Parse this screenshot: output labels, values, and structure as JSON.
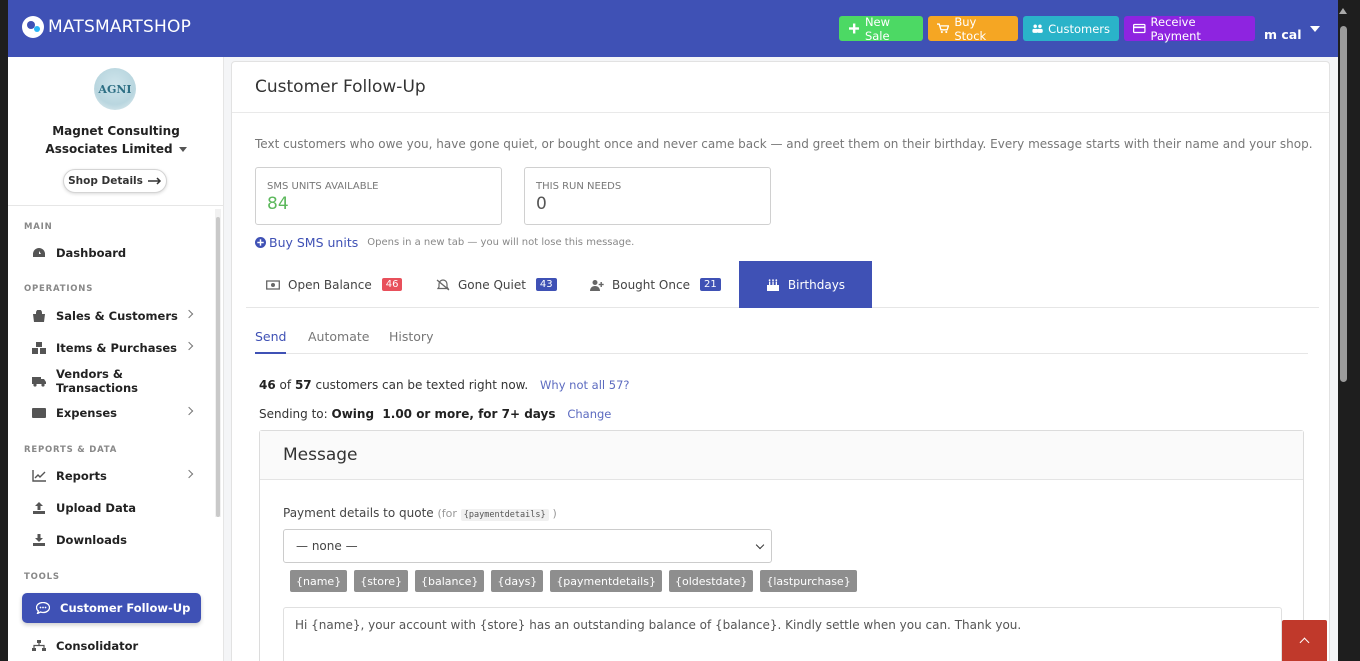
{
  "app": {
    "brand": "MATSMARTSHOP",
    "user": "m cal"
  },
  "topbar": {
    "new_sale": "New Sale",
    "buy_stock": "Buy Stock",
    "customers": "Customers",
    "receive_payment": "Receive Payment"
  },
  "sidebar": {
    "shop_logo_text": "AGNI",
    "shop_name": "Magnet Consulting Associates Limited",
    "shop_details": "Shop Details",
    "sections": {
      "main": "MAIN",
      "operations": "OPERATIONS",
      "reports": "REPORTS & DATA",
      "tools": "TOOLS"
    },
    "items": {
      "dashboard": "Dashboard",
      "sales": "Sales & Customers",
      "items": "Items & Purchases",
      "vendors": "Vendors & Transactions",
      "expenses": "Expenses",
      "reports": "Reports",
      "upload": "Upload Data",
      "downloads": "Downloads",
      "followup": "Customer Follow-Up",
      "consolidator": "Consolidator"
    }
  },
  "main": {
    "title": "Customer Follow-Up",
    "intro": "Text customers who owe you, have gone quiet, or bought once and never came back — and greet them on their birthday. Every message starts with their name and your shop.",
    "sms_label": "SMS UNITS AVAILABLE",
    "sms_value": "84",
    "run_label": "THIS RUN NEEDS",
    "run_value": "0",
    "buy_sms": "Buy SMS units",
    "buy_note": "Opens in a new tab — you will not lose this message.",
    "tabs": [
      {
        "label": "Open Balance",
        "count": "46",
        "color": "#e8505b"
      },
      {
        "label": "Gone Quiet",
        "count": "43",
        "color": "#3f51b5"
      },
      {
        "label": "Bought Once",
        "count": "21",
        "color": "#3f51b5"
      },
      {
        "label": "Birthdays"
      }
    ],
    "subtabs": {
      "send": "Send",
      "automate": "Automate",
      "history": "History"
    },
    "count_a": "46",
    "count_of": "of",
    "count_b": "57",
    "count_text": "customers can be texted right now.",
    "why_not": "Why not all 57?",
    "sending_label": "Sending to:",
    "sending_value": "Owing  1.00 or more, for 7+ days",
    "change": "Change",
    "card": {
      "title": "Message",
      "pd_label": "Payment details to quote",
      "pd_hint_open": "(for",
      "pd_code": "{paymentdetails}",
      "pd_hint_close": ")",
      "select_value": "— none —",
      "placeholders": [
        "{name}",
        "{store}",
        "{balance}",
        "{days}",
        "{paymentdetails}",
        "{oldestdate}",
        "{lastpurchase}"
      ],
      "message": "Hi {name}, your account with {store} has an outstanding balance of {balance}. Kindly settle when you can. Thank you."
    }
  },
  "colors": {
    "primary": "#3f51b5",
    "sms_value": "#5cb85c",
    "new_sale": "#4cd964",
    "buy_stock": "#f5a623",
    "customers": "#2ab3c9",
    "receive_payment": "#8e24e0",
    "scroll_top": "#c0392b"
  }
}
